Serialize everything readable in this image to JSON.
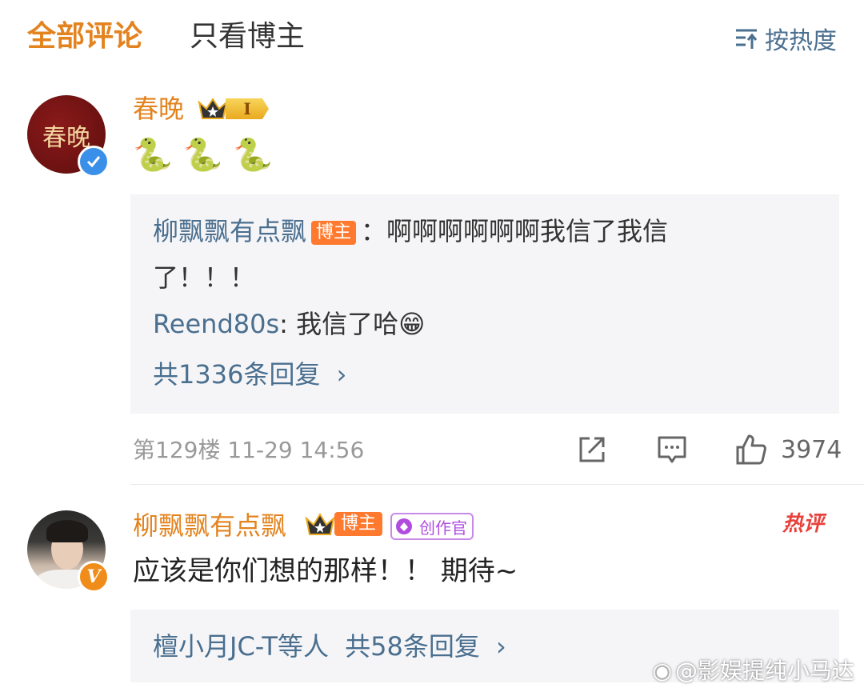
{
  "tabs": {
    "all_comments": "全部评论",
    "blogger_only": "只看博主"
  },
  "sort": {
    "label": "按热度",
    "icon": "sort-icon"
  },
  "comments": [
    {
      "username": "春晚",
      "avatar_text": "春晚",
      "level_badge": "I",
      "emoji": [
        "🐍",
        "🐍",
        "🐍"
      ],
      "replies": [
        {
          "author": "柳飘飘有点飘",
          "badge": "博主",
          "separator": "：",
          "text_line1": "啊啊啊啊啊啊我信了我信",
          "text_line2": "了！！！"
        },
        {
          "author": "Reend80s",
          "separator": ": ",
          "text": "我信了哈😁"
        }
      ],
      "reply_count": "共1336条回复",
      "meta": "第129楼  11-29 14:56",
      "like_count": "3974"
    },
    {
      "username": "柳飘飘有点飘",
      "badge": "博主",
      "creator_badge": "创作官",
      "hot_label": "热评",
      "content": "应该是你们想的那样！！ 期待~",
      "reply_summary_people": "檀小月JC-T等人",
      "reply_summary_count": "共58条回复"
    }
  ],
  "watermark": "@影娱提纯小马达",
  "colors": {
    "accent": "#e3831f",
    "link": "#4a6f8f",
    "badge": "#ff7a2e",
    "hot": "#e8413b",
    "creator": "#b04de0"
  }
}
